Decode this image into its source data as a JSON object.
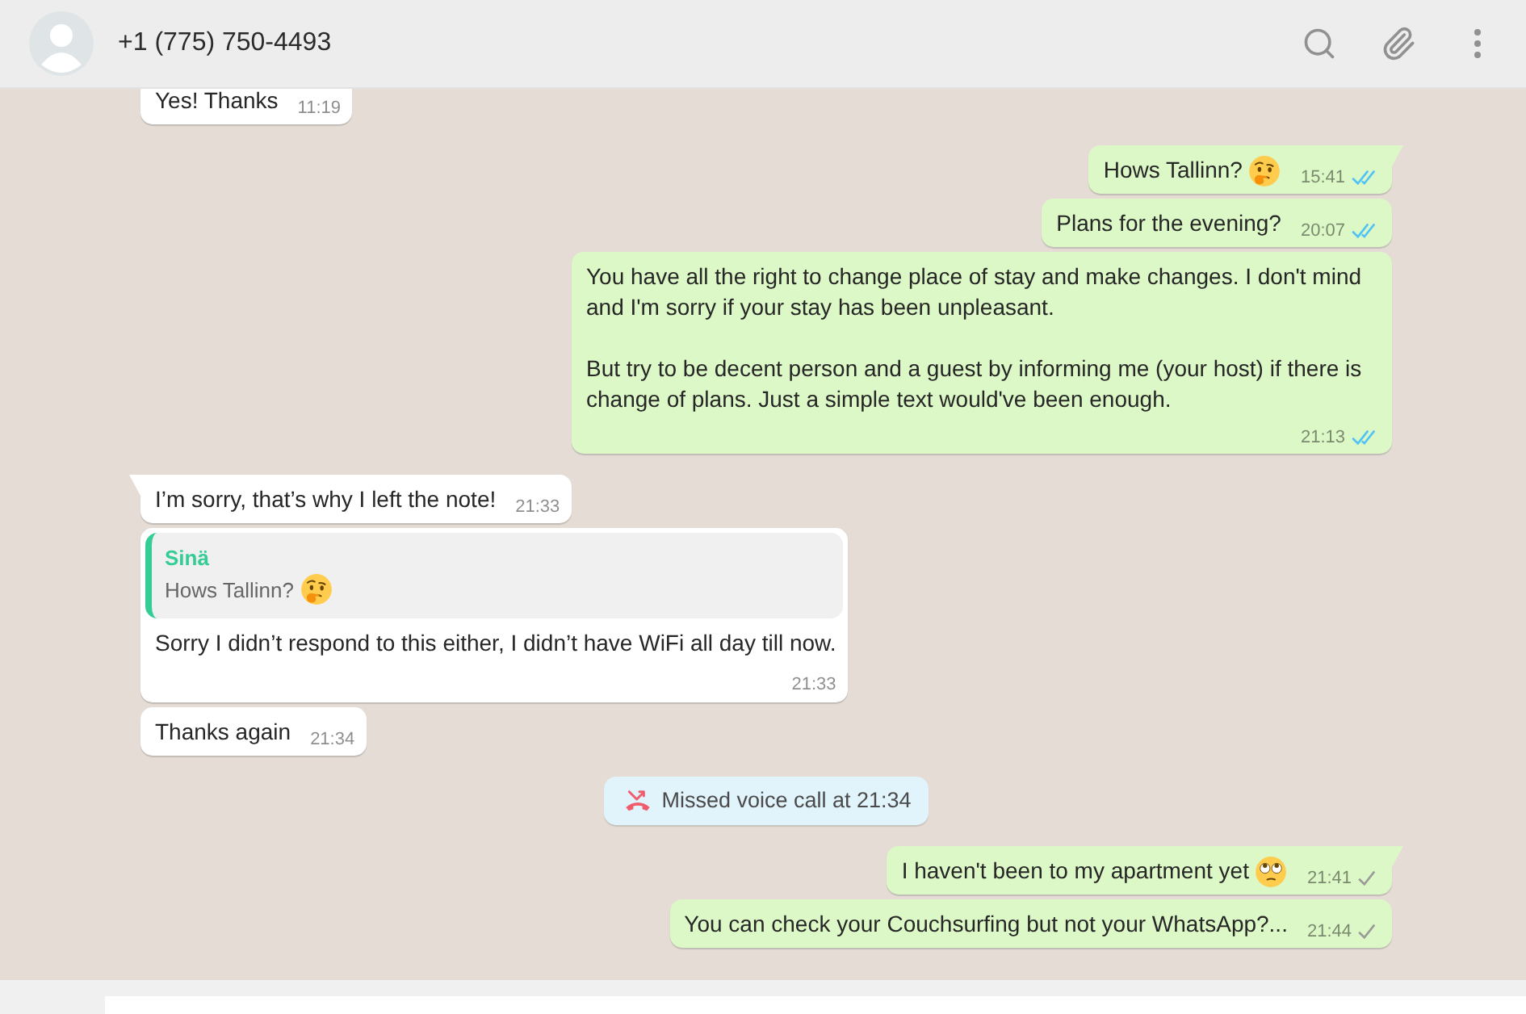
{
  "header": {
    "contact": "+1 (775) 750-4493"
  },
  "messages": [
    {
      "kind": "incoming",
      "tail": false,
      "text": "Yes! Thanks",
      "time": "11:19"
    },
    {
      "kind": "outgoing",
      "tail": true,
      "text": "Hows Tallinn?",
      "time": "15:41",
      "read": true
    },
    {
      "kind": "outgoing",
      "tail": false,
      "text": "Plans for the evening?",
      "time": "20:07",
      "read": true
    },
    {
      "kind": "outgoing",
      "tail": false,
      "text": "You have all the right to change place of stay and make changes. I don't mind and I'm sorry if your stay has been unpleasant.\n\nBut try to be decent person and a guest by informing me (your host) if there is change of plans. Just a simple text would've been enough.",
      "time": "21:13",
      "read": true
    },
    {
      "kind": "incoming",
      "tail": true,
      "text": "I’m sorry, that’s why I left the note!",
      "time": "21:33"
    },
    {
      "kind": "reply",
      "tail": false,
      "quote": {
        "author": "Sinä",
        "text": "Hows Tallinn?"
      },
      "text": "Sorry I didn’t respond to this either, I didn’t have WiFi all day till now.",
      "time": "21:33"
    },
    {
      "kind": "incoming",
      "tail": false,
      "text": "Thanks again",
      "time": "21:34"
    },
    {
      "kind": "notice",
      "text": "Missed voice call at 21:34"
    },
    {
      "kind": "outgoing",
      "tail": true,
      "text": "I haven't been to my apartment yet",
      "time": "21:41",
      "read": false
    },
    {
      "kind": "outgoing",
      "tail": false,
      "text": "You can check your Couchsurfing but not your WhatsApp?...",
      "time": "21:44",
      "read": false
    }
  ]
}
